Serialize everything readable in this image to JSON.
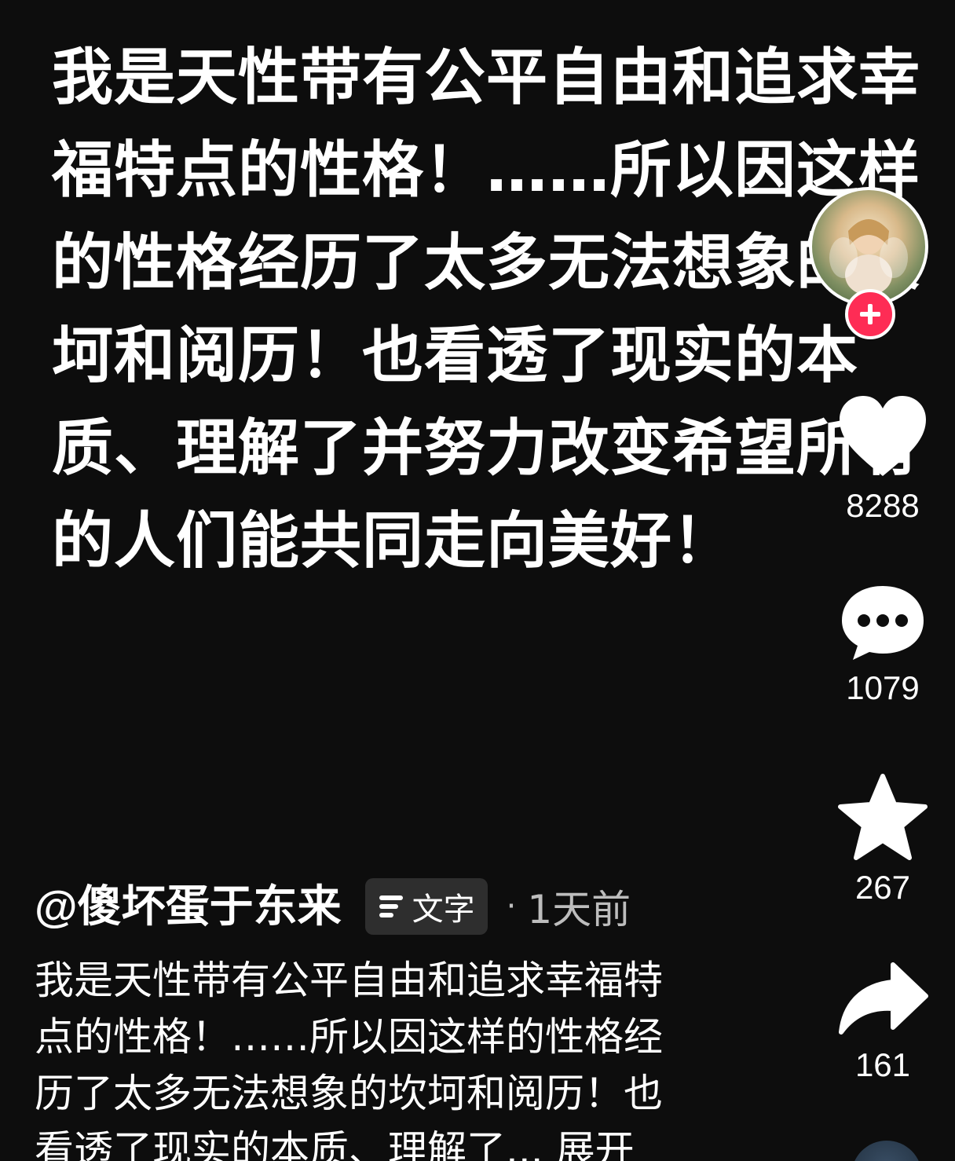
{
  "video_text": [
    "我是天性带有公平自由和追求幸",
    "福特点的性格！……所以因这样",
    "的性格经历了太多无法想象的坎",
    "坷和阅历！也看透了现实的本",
    "质、理解了并努力改变希望所有",
    "的人们能共同走向美好！"
  ],
  "rail": {
    "follow_icon": "plus-icon",
    "like": {
      "icon": "heart-icon",
      "count": "8288"
    },
    "comment": {
      "icon": "comment-icon",
      "count": "1079"
    },
    "favorite": {
      "icon": "star-icon",
      "count": "267"
    },
    "share": {
      "icon": "share-icon",
      "count": "161"
    }
  },
  "info": {
    "author": "@傻坏蛋于东来",
    "tag_label": "文字",
    "dot": "·",
    "time": "1天前",
    "caption_lines": [
      "我是天性带有公平自由和追求幸福特",
      "点的性格！……所以因这样的性格经",
      "历了太多无法想象的坎坷和阅历！也",
      "看透了现实的本质、理解了... 展开"
    ]
  },
  "colors": {
    "background": "#0d0d0d",
    "follow": "#fe2c55",
    "tag_bg": "#2e2e2e",
    "muted_text": "#bdbdbd"
  }
}
